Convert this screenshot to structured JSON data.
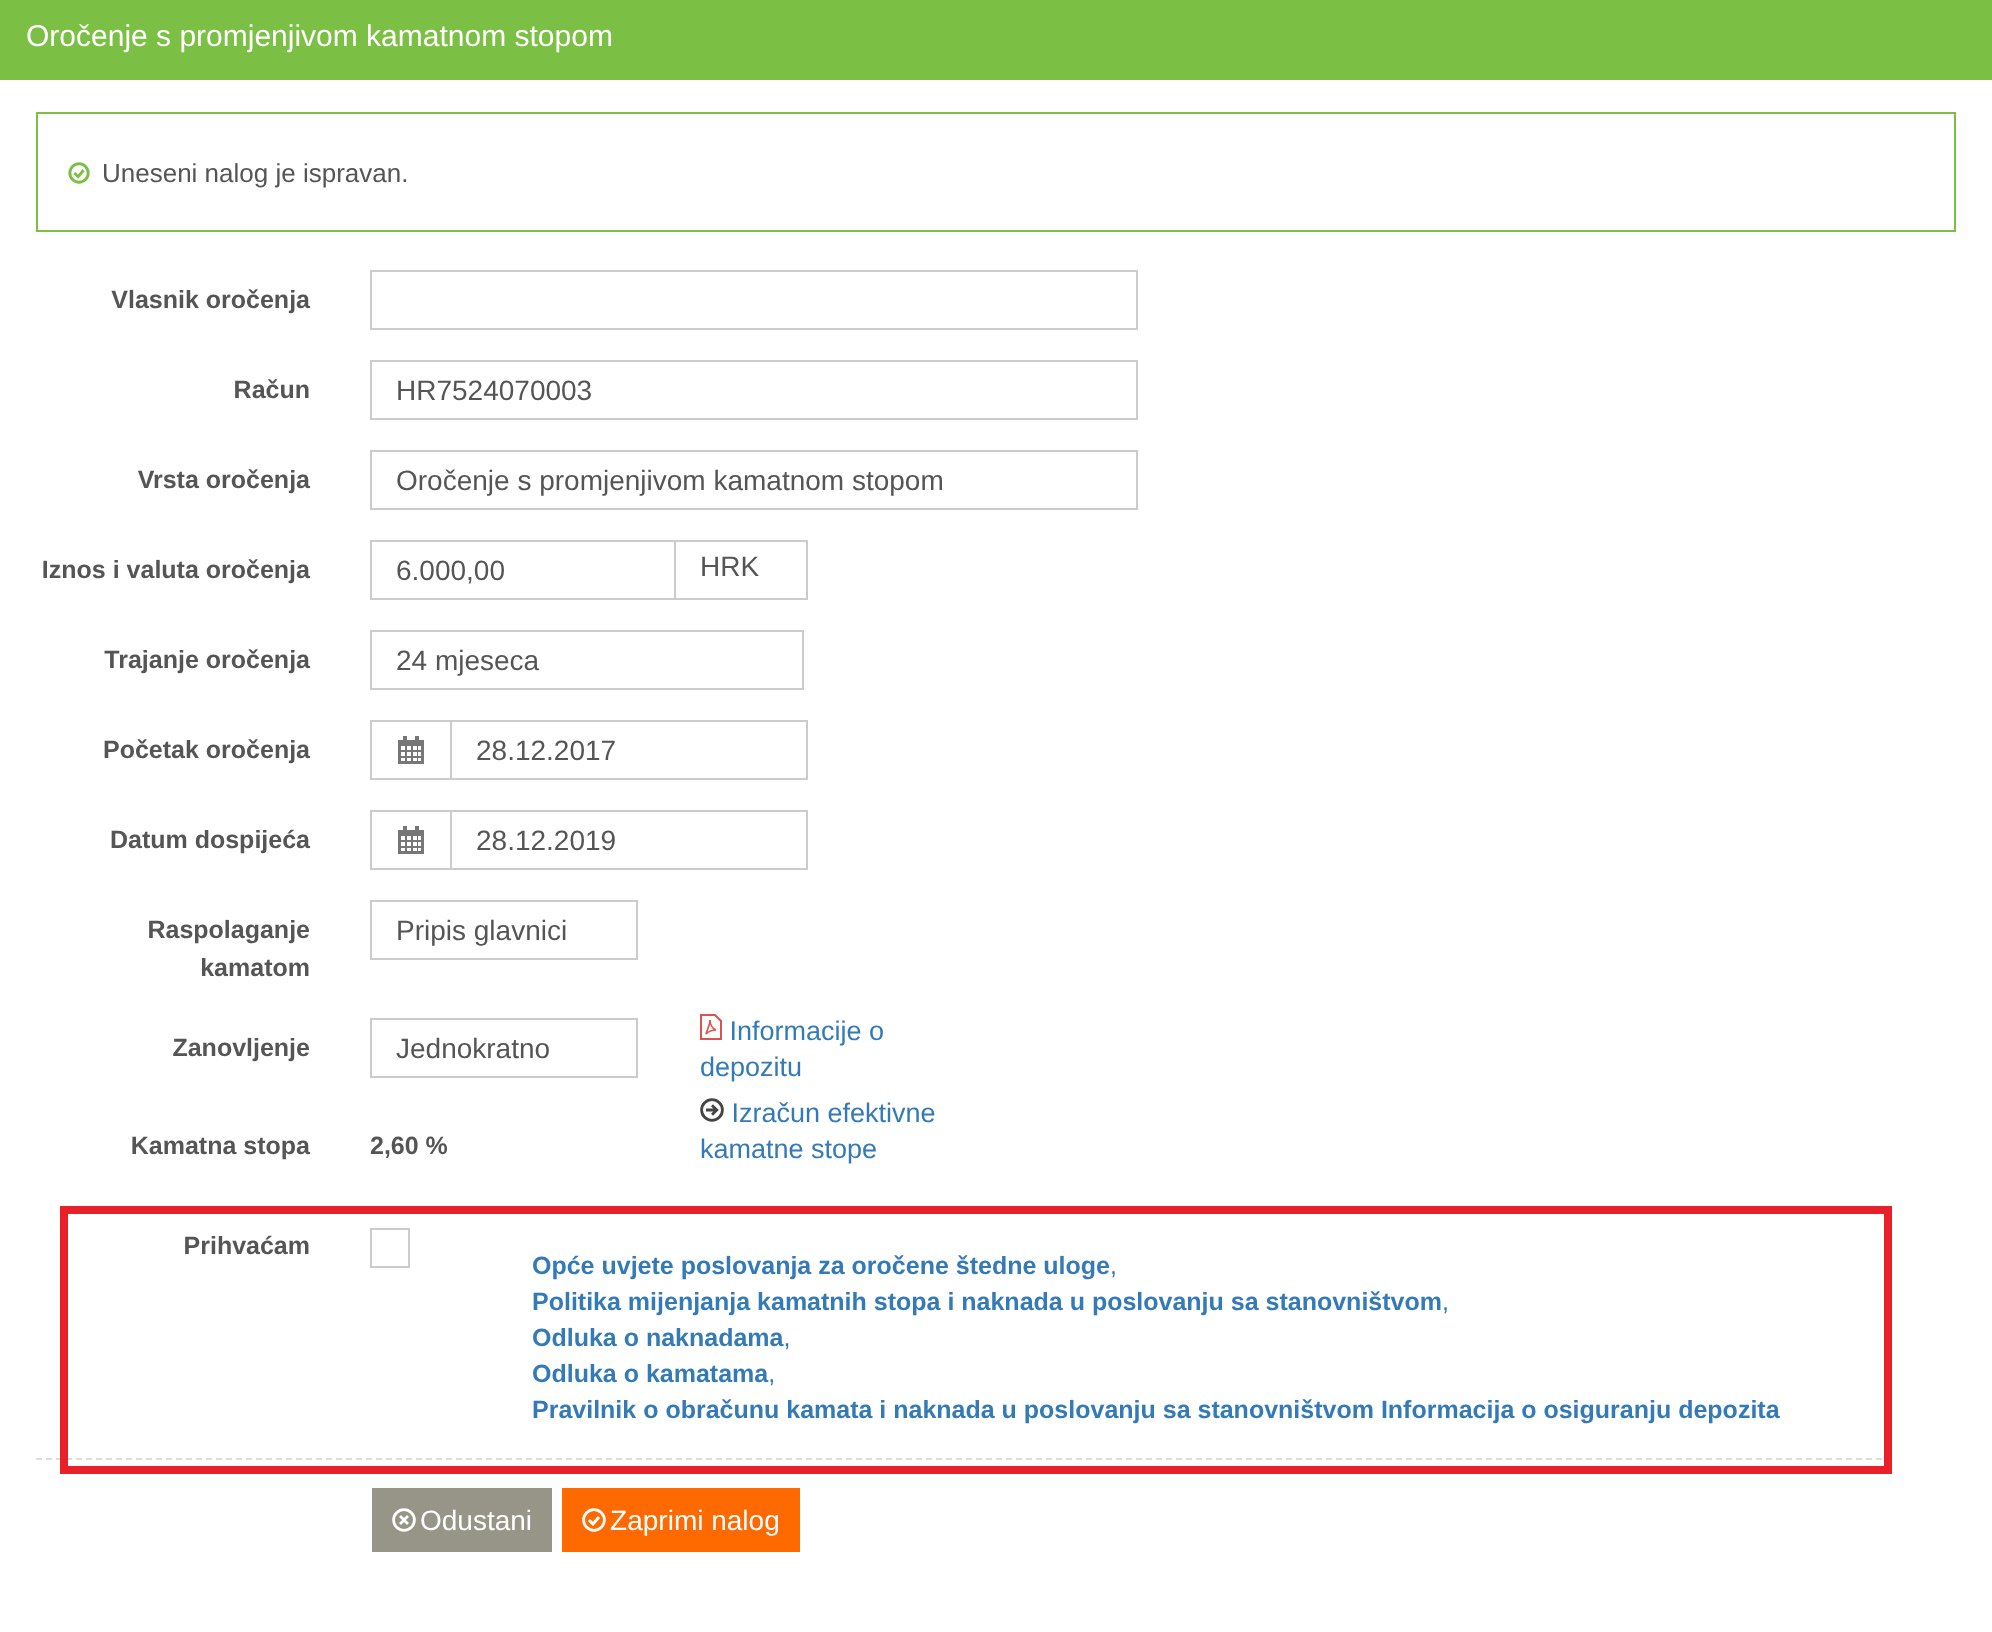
{
  "header": {
    "title": "Oročenje s promjenjivom kamatnom stopom"
  },
  "alert": {
    "message": "Uneseni nalog je ispravan."
  },
  "fields": [
    {
      "label": "Vlasnik oročenja",
      "kind": "wide"
    },
    {
      "label": "Račun",
      "kind": "wide",
      "value": "HR7524070003"
    },
    {
      "label": "Vrsta oročenja",
      "kind": "wide",
      "value": "Oročenje s promjenjivom kamatnom stopom"
    },
    {
      "label": "Iznos i valuta oročenja",
      "kind": "currency",
      "value": "6.000,00",
      "unit": "HRK"
    },
    {
      "label": "Trajanje oročenja",
      "kind": "medium",
      "value": "24 mjeseca"
    },
    {
      "label": "Početak oročenja",
      "kind": "date",
      "value": "28.12.2017"
    },
    {
      "label": "Datum dospijeća",
      "kind": "date",
      "value": "28.12.2019"
    },
    {
      "label": "Raspolaganje kamatom",
      "kind": "short",
      "value": "Pripis glavnici"
    },
    {
      "label": "Zanovljenje",
      "kind": "short",
      "value": "Jednokratno",
      "link": {
        "kind": "pdf",
        "text": "Informacije o depozitu"
      }
    },
    {
      "label": "Kamatna stopa",
      "kind": "static",
      "value": "2,60 %",
      "link": {
        "kind": "arrow",
        "text": "Izračun efektivne kamatne stope"
      }
    }
  ],
  "acceptance": {
    "label": "Prihvaćam",
    "checked": false,
    "terms": [
      [
        {
          "text": "Opće uvjete poslovanja za oročene štedne uloge",
          "punctuation": ","
        }
      ],
      [
        {
          "text": "Politika mijenjanja kamatnih stopa i naknada u poslovanju sa stanovništvom",
          "punctuation": ","
        }
      ],
      [
        {
          "text": "Odluka o naknadama",
          "punctuation": ","
        }
      ],
      [
        {
          "text": "Odluka o kamatama",
          "punctuation": ","
        }
      ],
      [
        {
          "text": "Pravilnik o obračunu kamata i naknada u poslovanju sa stanovništvom"
        },
        {
          "text": "Informacija o osiguranju depozita"
        }
      ]
    ]
  },
  "buttons": [
    {
      "kind": "cancel",
      "label": "Odustani"
    },
    {
      "kind": "submit",
      "label": "Zaprimi nalog"
    }
  ]
}
